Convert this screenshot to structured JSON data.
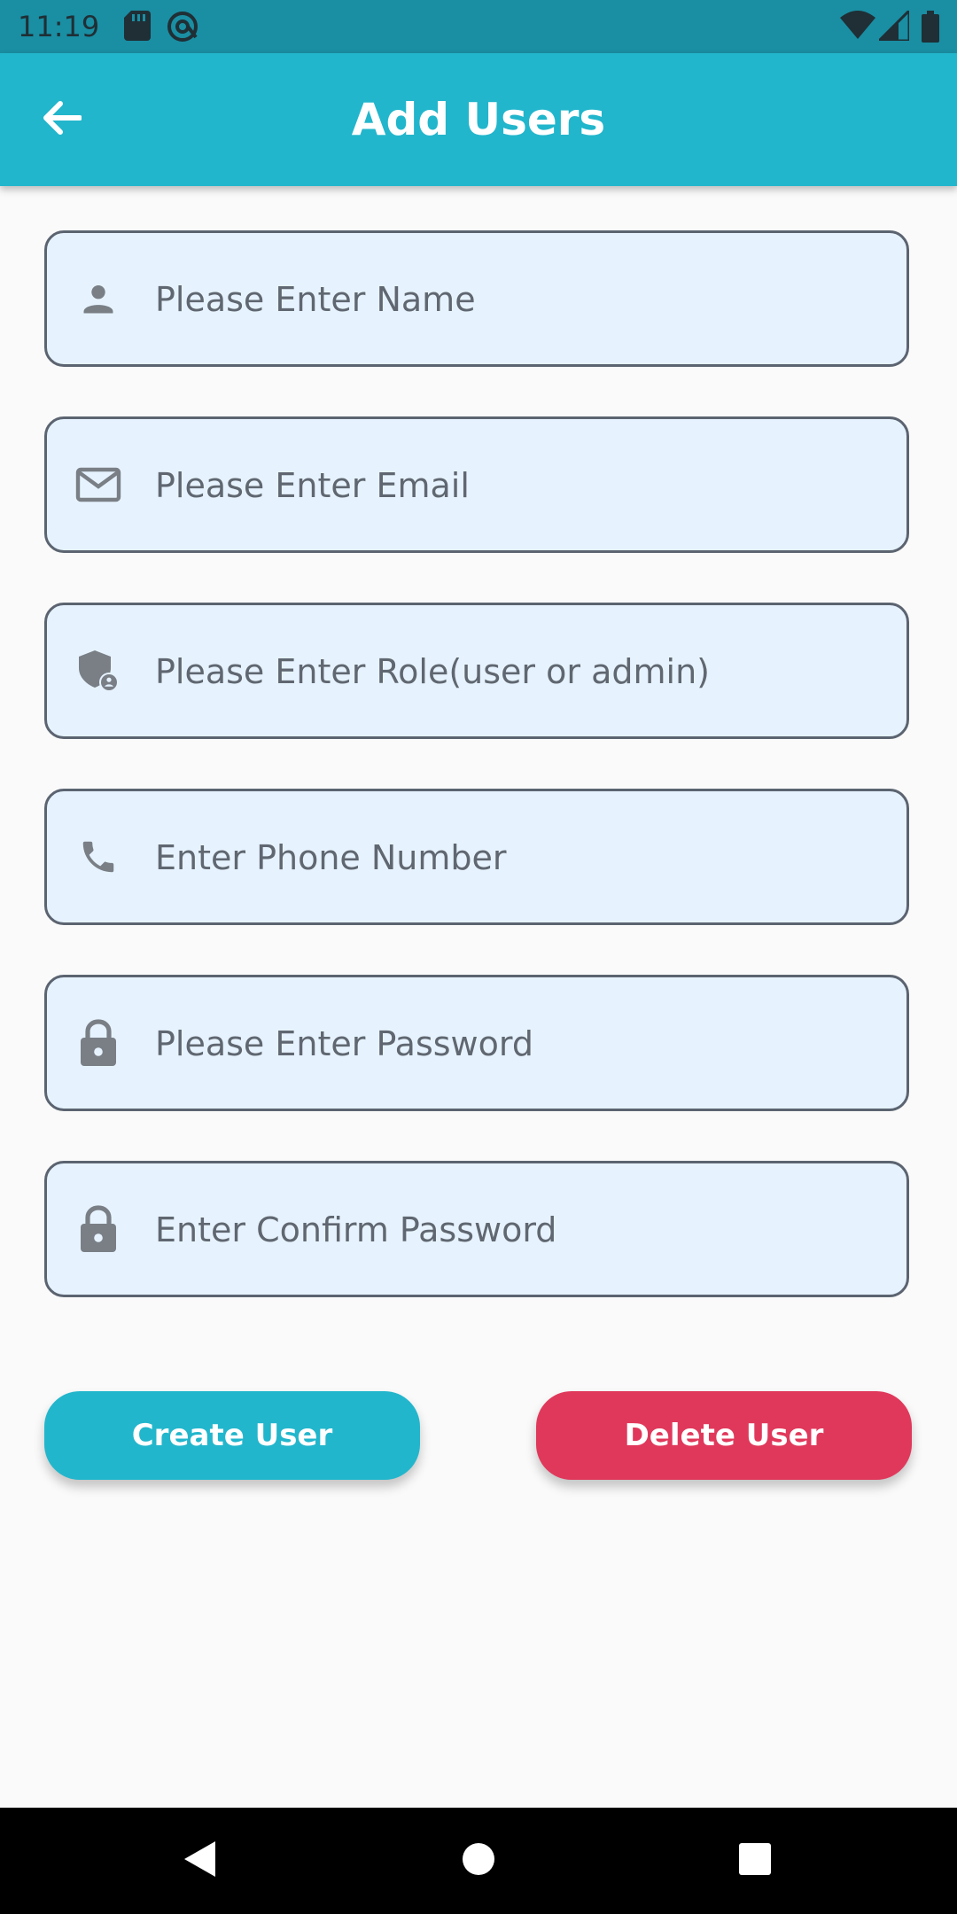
{
  "status_bar": {
    "time": "11:19",
    "icons": [
      "sd-card-icon",
      "at-sign-icon",
      "wifi-icon",
      "signal-icon",
      "battery-icon"
    ]
  },
  "app_bar": {
    "title": "Add Users",
    "back_icon": "arrow-left-icon",
    "background_color": "#22b6cc"
  },
  "form": {
    "fields": [
      {
        "name": "name",
        "icon": "person-icon",
        "placeholder": "Please Enter Name",
        "value": ""
      },
      {
        "name": "email",
        "icon": "mail-icon",
        "placeholder": "Please Enter Email",
        "value": ""
      },
      {
        "name": "role",
        "icon": "admin-shield-icon",
        "placeholder": "Please Enter Role(user or admin)",
        "value": ""
      },
      {
        "name": "phone",
        "icon": "phone-icon",
        "placeholder": "Enter Phone Number",
        "value": ""
      },
      {
        "name": "password",
        "icon": "lock-icon",
        "placeholder": "Please Enter Password",
        "value": ""
      },
      {
        "name": "confirm_password",
        "icon": "lock-icon",
        "placeholder": "Enter Confirm Password",
        "value": ""
      }
    ],
    "field_background": "#e6f3ff"
  },
  "actions": {
    "create_label": "Create User",
    "create_color": "#22b6cc",
    "delete_label": "Delete User",
    "delete_color": "#e0385b"
  },
  "nav_bar": {
    "icons": [
      "back-triangle-icon",
      "home-circle-icon",
      "recents-square-icon"
    ]
  }
}
